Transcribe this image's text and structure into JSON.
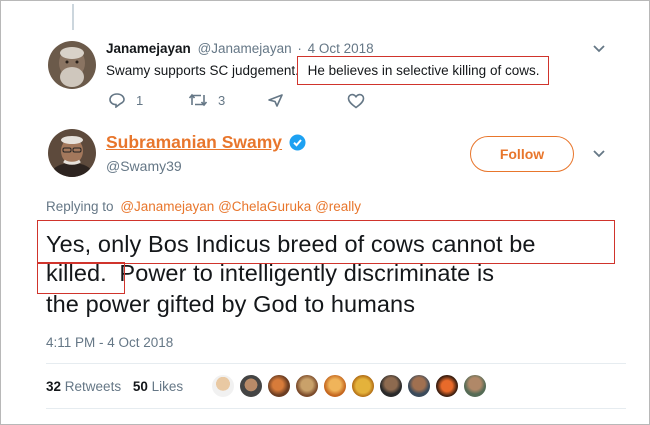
{
  "parent_tweet": {
    "display_name": "Janamejayan",
    "handle": "@Janamejayan",
    "separator": "·",
    "date": "4 Oct 2018",
    "text_part1": "Swamy supports SC judgement.",
    "text_part2": "He believes in selective killing of cows.",
    "reply_count": "1",
    "retweet_count": "3"
  },
  "main_tweet": {
    "display_name": "Subramanian Swamy",
    "handle": "@Swamy39",
    "follow_label": "Follow",
    "replying_to_label": "Replying to",
    "replying_to_users": "@Janamejayan @ChelaGuruka @really",
    "text_line1": "Yes, only Bos Indicus breed of cows cannot be",
    "text_line2a": "killed.",
    "text_line2b": "Power to intelligently discriminate is",
    "text_line3": "the power gifted by God to humans",
    "timestamp": "4:11 PM - 4 Oct 2018",
    "retweets_count": "32",
    "retweets_label": "Retweets",
    "likes_count": "50",
    "likes_label": "Likes"
  },
  "colors": {
    "accent": "#e8762c",
    "verified": "#1da1f2",
    "highlight": "#d0342c",
    "muted": "#657786"
  },
  "icons": [
    "reply-icon",
    "retweet-icon",
    "direct-message-icon",
    "like-icon",
    "chevron-down-icon",
    "verified-badge-icon"
  ]
}
